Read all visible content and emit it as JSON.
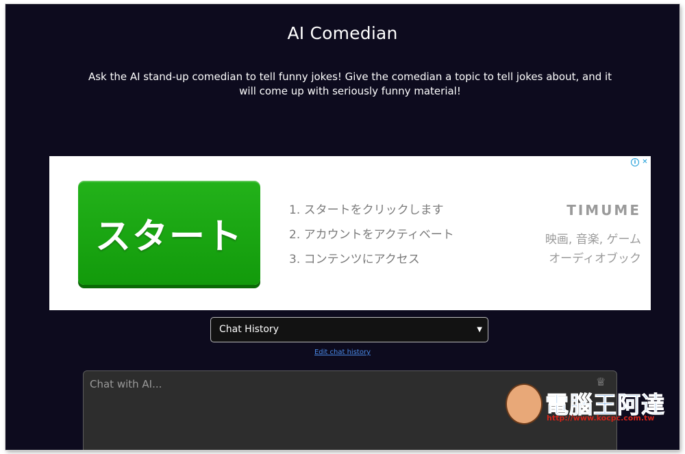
{
  "page": {
    "title": "AI Comedian",
    "description": "Ask the AI stand-up comedian to tell funny jokes! Give the comedian a topic to tell jokes about, and it will come up with seriously funny material!"
  },
  "ad": {
    "button_label": "スタート",
    "steps": [
      "1. スタートをクリックします",
      "2. アカウントをアクティベート",
      "3. コンテンツにアクセス"
    ],
    "brand": "TIMUME",
    "brand_lines": [
      "映画, 音楽, ゲーム",
      "オーディオブック"
    ],
    "info_icon": "i",
    "close_icon": "✕"
  },
  "chat": {
    "history_select": "Chat History",
    "edit_history_link": "Edit chat history",
    "input_placeholder": "Chat with AI..."
  },
  "watermark": {
    "title": "電腦王阿達",
    "url": "http://www.kocpc.com.tw"
  },
  "colors": {
    "background": "#0d0b1e",
    "ad_button": "#19a612",
    "link": "#4a8ae8"
  }
}
